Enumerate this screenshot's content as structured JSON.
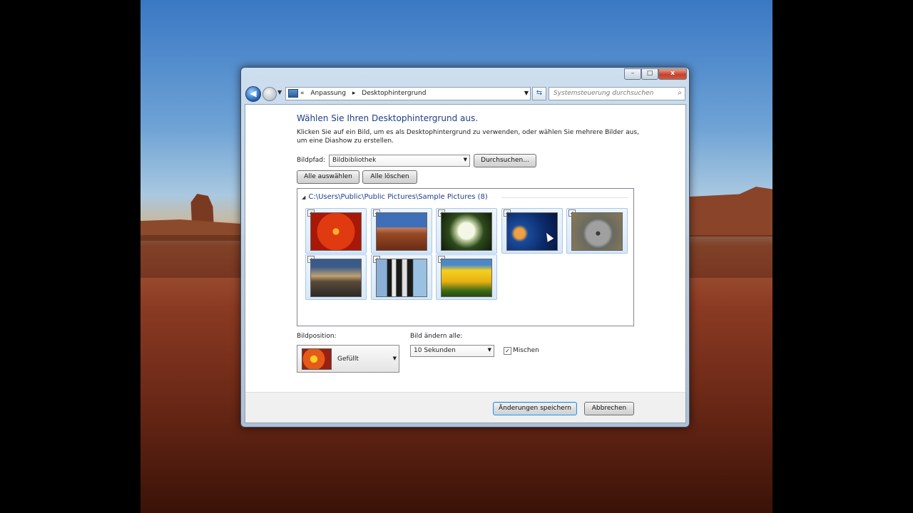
{
  "window": {
    "breadcrumb": [
      "«",
      "Anpassung",
      "▸",
      "Desktophintergrund"
    ],
    "search_placeholder": "Systemsteuerung durchsuchen",
    "caption": {
      "minimize": "–",
      "maximize": "□",
      "close": "x"
    }
  },
  "content": {
    "title": "Wählen Sie Ihren Desktophintergrund aus.",
    "description": "Klicken Sie auf ein Bild, um es als Desktophintergrund zu verwenden, oder wählen Sie mehrere Bilder aus, um eine Diashow zu erstellen.",
    "picture_location_label": "Bildpfad:",
    "picture_location_value": "Bildbibliothek",
    "browse_button": "Durchsuchen...",
    "select_all_button": "Alle auswählen",
    "clear_all_button": "Alle löschen",
    "group_header": "C:\\Users\\Public\\Public Pictures\\Sample Pictures (8)",
    "group_arrow": "◢",
    "thumbnails": [
      {
        "name": "Chrysanthemum",
        "checked": "✓"
      },
      {
        "name": "Desert",
        "checked": "✓"
      },
      {
        "name": "Hydrangeas",
        "checked": "✓"
      },
      {
        "name": "Jellyfish",
        "checked": "✓"
      },
      {
        "name": "Koala",
        "checked": "✓"
      },
      {
        "name": "Lighthouse",
        "checked": "✓"
      },
      {
        "name": "Penguins",
        "checked": "✓"
      },
      {
        "name": "Tulips",
        "checked": "✓"
      }
    ],
    "position_label": "Bildposition:",
    "position_value": "Gefüllt",
    "interval_label": "Bild ändern alle:",
    "interval_value": "10 Sekunden",
    "shuffle_label": "Mischen",
    "shuffle_checked": "✓",
    "save_button": "Änderungen speichern",
    "cancel_button": "Abbrechen"
  },
  "icons": {
    "back": "◀",
    "dropdown": "▼",
    "refresh": "⇆",
    "search": "⌕"
  }
}
